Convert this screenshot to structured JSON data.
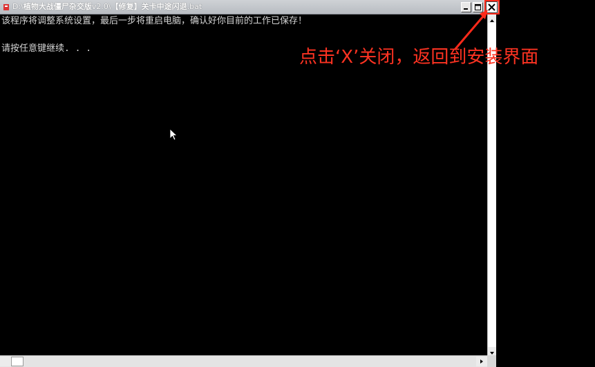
{
  "window": {
    "title_prefix": "D:\\",
    "title_bold1": "植物大战僵尸杂交版",
    "title_version": "v2.0\\",
    "title_bold2": "【修复】关卡中途闪退",
    "title_ext": ".bat",
    "minimize_icon": "minimize-icon",
    "maximize_icon": "maximize-icon",
    "close_icon": "close-icon",
    "close_glyph": "✕"
  },
  "console": {
    "line1": "该程序将调整系统设置，最后一步将重启电脑，确认好你目前的工作已保存！",
    "line2": "请按任意键继续. . ."
  },
  "annotation": {
    "text": "点击‘X’关闭，返回到安装界面",
    "color": "#ff3322"
  },
  "colors": {
    "console_bg": "#000000",
    "console_text": "#d4d4d4",
    "annotation_red": "#ff3322"
  }
}
